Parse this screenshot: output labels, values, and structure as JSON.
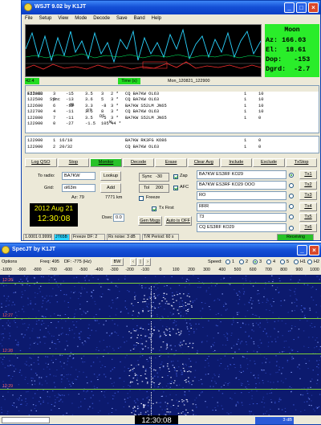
{
  "wsjt": {
    "title": "WSJT 9.02   by K1JT",
    "menu": [
      "File",
      "Setup",
      "View",
      "Mode",
      "Decode",
      "Save",
      "Band",
      "Help"
    ],
    "moon": {
      "label": "Moon",
      "az": "Az: 166.03",
      "el": "El:  18.61",
      "dop": "Dop:   -153",
      "dgrd": "Dgrd:  -2.7"
    },
    "status_left": "42.4",
    "status_time": "Time (s)",
    "status_file": "Mon_120821_122900",
    "table_header": {
      "file": "FileID",
      "sync": "Sync",
      "db": "dB",
      "dt": "DT",
      "df": "DF",
      "w": "W"
    },
    "decodes": [
      {
        "file": "122300",
        "sync": "3",
        "db": "-15",
        "dt": "3.5",
        "df": "3",
        "w": "2 *",
        "msg": "CQ BA7KW OL63",
        "a": "1",
        "b": "10"
      },
      {
        "file": "122500",
        "sync": "5",
        "db": "-13",
        "dt": "3.6",
        "df": "5",
        "w": "3 *",
        "msg": "CQ BA7KW OL63",
        "a": "1",
        "b": "10"
      },
      {
        "file": "122600",
        "sync": "6",
        "db": "-12",
        "dt": "3.3",
        "df": "-8",
        "w": "3 *",
        "msg": "BA7KW S52LM JN65",
        "a": "1",
        "b": "10"
      },
      {
        "file": "122700",
        "sync": "4",
        "db": "-11",
        "dt": "3.5",
        "df": "8",
        "w": "3 *",
        "msg": "CQ BA7KW OL63",
        "a": "1",
        "b": "10"
      },
      {
        "file": "122800",
        "sync": "7",
        "db": "-11",
        "dt": "3.5",
        "df": "-5",
        "w": "3 *",
        "msg": "BA7KW S52LM JN65",
        "a": "1",
        "b": "0"
      },
      {
        "file": "122900",
        "sync": "0",
        "db": "-27",
        "dt": "-1.5",
        "df": "105",
        "w": "44 *",
        "msg": "",
        "a": "",
        "b": ""
      }
    ],
    "decodes2": [
      {
        "file": "122900",
        "sync": "1",
        "db": "16/18",
        "msg": "BA7KW RK3FG KO86",
        "a": "1",
        "b": "0"
      },
      {
        "file": "122900",
        "sync": "2",
        "db": "20/32",
        "msg": "CQ BA7KW OL63",
        "a": "1",
        "b": "0"
      }
    ],
    "buttons": [
      "Log QSO",
      "Stop",
      "Monitor",
      "Decode",
      "Erase",
      "Clear Avg",
      "Include",
      "Exclude",
      "TxStop"
    ],
    "to_radio_label": "To radio:",
    "to_radio_value": "BA7KW",
    "lookup": "Lookup",
    "grid_label": "Grid:",
    "grid_value": "ol63m",
    "add": "Add",
    "az_text": "Az: 79",
    "km_text": "7771 km",
    "date": "2012 Aug 21",
    "clock": "12:30:08",
    "dsec_label": "Dsec",
    "dsec_value": "0.0",
    "sync_label": "Sync",
    "sync_value": "-30",
    "tol_label": "Tol",
    "tol_value": "200",
    "zap": "Zap",
    "afc": "AFC",
    "freeze": "Freeze",
    "tx_first": "Tx First",
    "gen_msgs": "Gen Msgs",
    "auto_off": "Auto is OFF",
    "tx_msgs": [
      "BA7KW ES3RF KO29",
      "BA7KW ES3RF KO29 OOO",
      "RO",
      "RRR",
      "73",
      "CQ ES3RF KO29"
    ],
    "tx_buttons": [
      "Tx1",
      "Tx2",
      "Tx3",
      "Tx4",
      "Tx5",
      "Tx6"
    ],
    "status_bar": [
      "1.0001 0.9999",
      "JT65B",
      "Freeze DF: 2",
      "Rx noise: 3 dB",
      "T/R Period: 60 s",
      "Receiving"
    ]
  },
  "spec": {
    "title": "SpecJT   by K1JT",
    "options": "Options",
    "freq": "Freq: 495",
    "df": "DF: -775 (Hz)",
    "bw": "BW",
    "speed_label": "Speed:",
    "speeds": [
      "1",
      "2",
      "3",
      "4",
      "5",
      "H1",
      "H2"
    ],
    "axis": [
      "-1000",
      "-900",
      "-800",
      "-700",
      "-600",
      "-500",
      "-400",
      "-300",
      "-200",
      "-100",
      "0",
      "100",
      "200",
      "300",
      "400",
      "500",
      "600",
      "700",
      "800",
      "900",
      "1000"
    ],
    "bands": [
      "12:26",
      "12:27",
      "12:28",
      "12:29"
    ],
    "clock": "12:30:08",
    "db": "3 dB"
  },
  "colors": {
    "accent": "#0a3ec6",
    "green": "#22dd22",
    "receiving": "#29c229",
    "clock_bg": "#000000",
    "clock_fg": "#ffff00"
  }
}
